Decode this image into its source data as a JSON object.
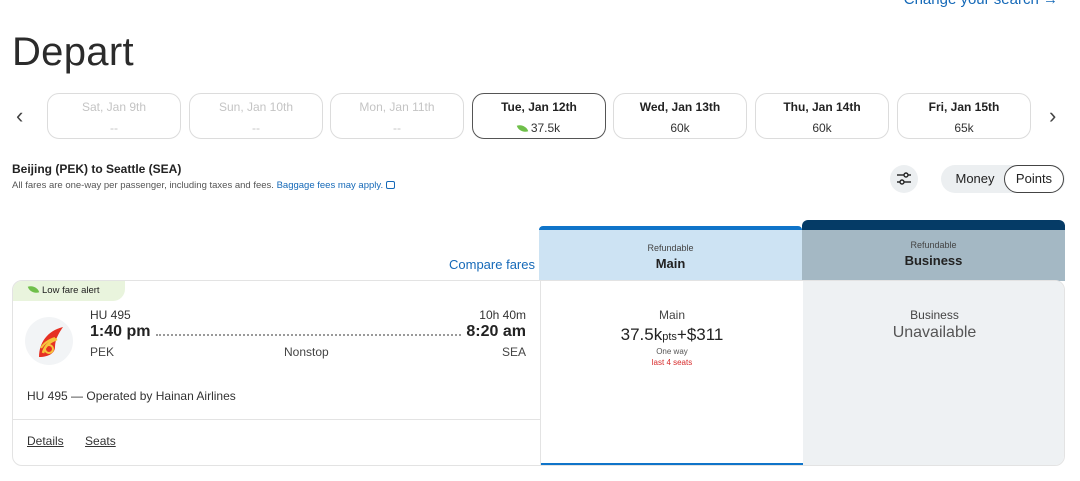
{
  "header": {
    "change_search": "Change your search →",
    "title": "Depart"
  },
  "date_strip": {
    "prev_arrow": "‹",
    "next_arrow": "›",
    "dates": [
      {
        "date": "Sat, Jan 9th",
        "price": "--",
        "state": "disabled"
      },
      {
        "date": "Sun, Jan 10th",
        "price": "--",
        "state": "disabled"
      },
      {
        "date": "Mon, Jan 11th",
        "price": "--",
        "state": "disabled"
      },
      {
        "date": "Tue, Jan 12th",
        "price": "37.5k",
        "state": "selected",
        "low_fare": true
      },
      {
        "date": "Wed, Jan 13th",
        "price": "60k",
        "state": "available"
      },
      {
        "date": "Thu, Jan 14th",
        "price": "60k",
        "state": "available"
      },
      {
        "date": "Fri, Jan 15th",
        "price": "65k",
        "state": "available"
      }
    ]
  },
  "route": {
    "title": "Beijing (PEK) to Seattle (SEA)",
    "note": "All fares are one-way per passenger, including taxes and fees.",
    "baggage_link": "Baggage fees may apply."
  },
  "controls": {
    "filter_icon": "sliders-icon",
    "money_label": "Money",
    "points_label": "Points",
    "selected_mode": "Points"
  },
  "columns": {
    "compare_fares": "Compare fares",
    "main": {
      "refundable": "Refundable",
      "name": "Main",
      "color": "#cde3f3",
      "accent": "#0f74c9"
    },
    "business": {
      "refundable": "Refundable",
      "name": "Business",
      "color": "#a4b8c4",
      "accent": "#053b66"
    }
  },
  "flight": {
    "alert": "Low fare alert",
    "flight_number": "HU 495",
    "duration": "10h 40m",
    "depart_time": "1:40 pm",
    "arrive_time": "8:20 am",
    "depart_airport": "PEK",
    "arrive_airport": "SEA",
    "stops": "Nonstop",
    "operated_by": "HU 495 — Operated by Hainan Airlines",
    "details_link": "Details",
    "seats_link": "Seats",
    "airline_logo": "hainan-airlines-logo"
  },
  "fares": {
    "main": {
      "label": "Main",
      "points": "37.5k",
      "points_unit": "pts",
      "plus": "+",
      "cash": "$311",
      "trip_type": "One way",
      "seats_left": "last 4 seats"
    },
    "business": {
      "label": "Business",
      "status": "Unavailable"
    }
  }
}
